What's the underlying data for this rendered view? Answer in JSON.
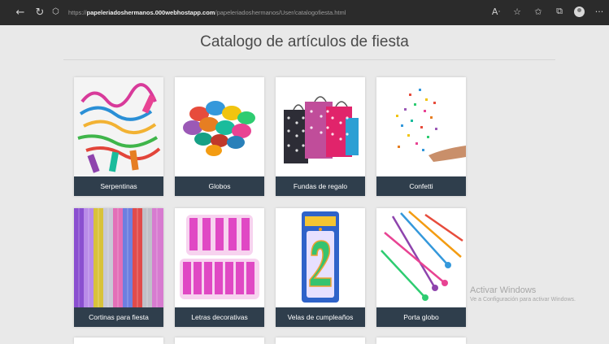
{
  "browser": {
    "url_protocol": "https://",
    "url_domain": "papeleriadoshermanos.000webhostapp.com",
    "url_path": "/papeleriadoshermanos/User/catalogofiesta.html",
    "icons": [
      "back-arrow-icon",
      "reload-icon",
      "lock-icon",
      "read-aloud-icon",
      "favorite-icon",
      "collections-icon",
      "tabs-icon",
      "profile-avatar-icon",
      "more-icon"
    ]
  },
  "page": {
    "title": "Catalogo de artículos de fiesta"
  },
  "catalog": {
    "items": [
      {
        "label": "Serpentinas",
        "image": "serpentine-streamers-image"
      },
      {
        "label": "Globos",
        "image": "balloons-image"
      },
      {
        "label": "Fundas de regalo",
        "image": "gift-bags-image"
      },
      {
        "label": "Confetti",
        "image": "confetti-image"
      },
      {
        "label": "Cortinas para fiesta",
        "image": "foil-curtains-image"
      },
      {
        "label": "Letras decorativas",
        "image": "happy-birthday-letters-image"
      },
      {
        "label": "Velas de cumpleaños",
        "image": "number-candle-image"
      },
      {
        "label": "Porta globo",
        "image": "balloon-sticks-image"
      }
    ],
    "caption_color": "#2f3e4c"
  },
  "watermark": {
    "title": "Activar Windows",
    "subtitle": "Ve a Configuración para activar Windows."
  }
}
